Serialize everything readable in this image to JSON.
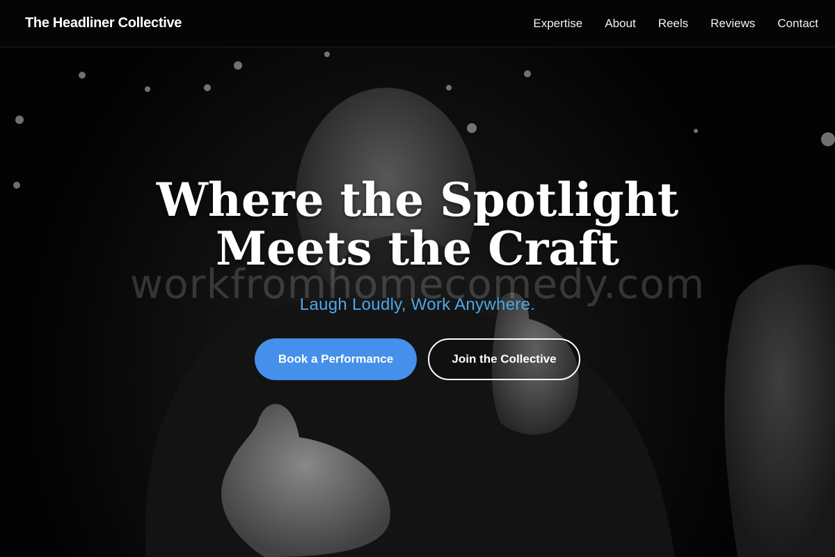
{
  "header": {
    "brand": "The Headliner Collective",
    "nav": [
      "Expertise",
      "About",
      "Reels",
      "Reviews",
      "Contact"
    ]
  },
  "hero": {
    "headline_line1": "Where the Spotlight",
    "headline_line2": "Meets the Craft",
    "watermark": "workfromhomecomedy.com",
    "tagline": "Laugh Loudly, Work Anywhere.",
    "primary_button": "Book a Performance",
    "secondary_button": "Join the Collective"
  },
  "colors": {
    "accent": "#4590ea",
    "tagline": "#4ea7ea",
    "background": "#000000"
  }
}
